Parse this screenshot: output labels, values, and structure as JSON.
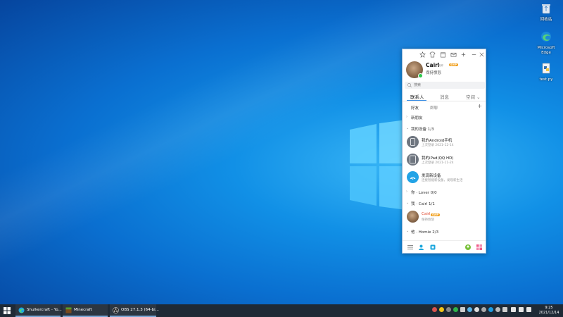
{
  "desktop": {
    "icons": [
      {
        "name": "recycle-bin-icon",
        "label": "回收站"
      },
      {
        "name": "edge-icon",
        "label": "Microsoft Edge"
      },
      {
        "name": "python-file-icon",
        "label": "test.py"
      }
    ]
  },
  "qq": {
    "profile": {
      "name": "Cairl",
      "level_badge": "SVIP",
      "status": "保持愤怒",
      "extra": "昵称"
    },
    "search": {
      "placeholder": "搜索"
    },
    "tabs": [
      {
        "label": "联系人",
        "active": true
      },
      {
        "label": "消息",
        "active": false
      },
      {
        "label": "空间 ⌄",
        "active": false
      }
    ],
    "subtabs": [
      {
        "label": "好友",
        "active": true
      },
      {
        "label": "群聊",
        "active": false
      }
    ],
    "list": [
      {
        "kind": "group",
        "label": "新朋友",
        "arrow": "›"
      },
      {
        "kind": "group",
        "label": "我的设备 1/3",
        "arrow": "⌄"
      },
      {
        "kind": "item",
        "title": "我的Android手机",
        "sub": "上次登录  2021-12-14",
        "icon": "phone-device-icon"
      },
      {
        "kind": "item",
        "title": "我的iPad(QQ HD)",
        "sub": "上次登录  2021-11-24",
        "icon": "tablet-device-icon"
      },
      {
        "kind": "item",
        "title": "发现新设备",
        "sub": "连接智能新设备，发现新生活",
        "icon": "discover-device-icon"
      },
      {
        "kind": "group",
        "label": "你 · Lover 0/0",
        "arrow": "›"
      },
      {
        "kind": "group",
        "label": "我 · Cairl 1/1",
        "arrow": "⌄"
      },
      {
        "kind": "item",
        "title": "Cairl",
        "sub": "保持愤怒",
        "icon": "friend-avatar-icon",
        "vip": true
      },
      {
        "kind": "group",
        "label": "他 · Homie 2/3",
        "arrow": "⌄"
      }
    ]
  },
  "taskbar": {
    "items": [
      {
        "label": "Shulkercraft - Yo...",
        "icon_color": "#1aa7e8"
      },
      {
        "label": "Minecraft",
        "icon_color": "#7a4b1e"
      },
      {
        "label": "OBS 27.1.3 (64-bi...",
        "icon_color": "#222222"
      }
    ],
    "clock": {
      "time": "9:25",
      "date": "2021/12/14"
    }
  }
}
